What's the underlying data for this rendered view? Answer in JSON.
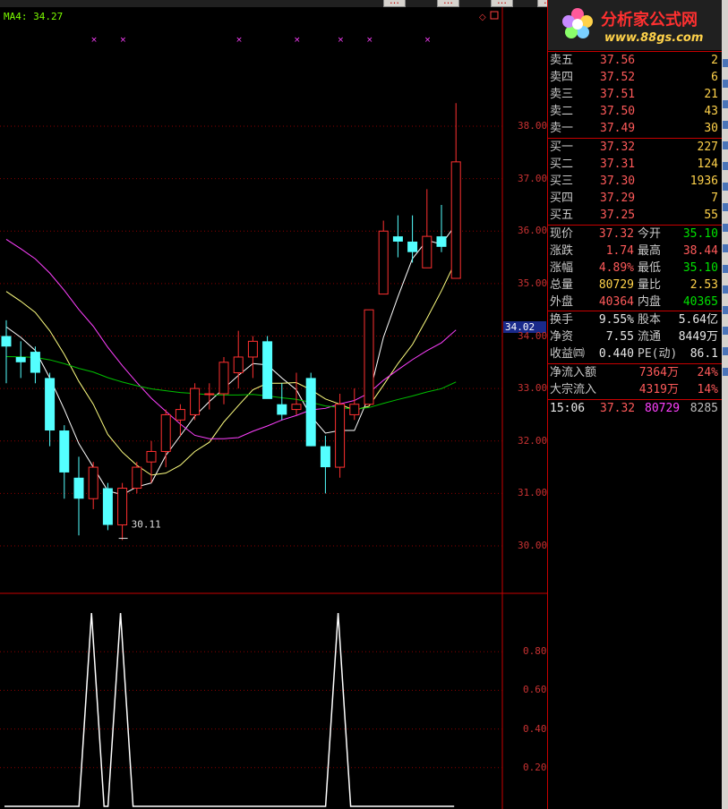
{
  "toolbar": {
    "buttons": [
      "…",
      "…",
      "…",
      "…"
    ]
  },
  "indicator": {
    "ma_label": "MA4: 34.27"
  },
  "price_axis": {
    "ticks": [
      "38.00",
      "37.00",
      "36.00",
      "35.00",
      "34.00",
      "33.00",
      "32.00",
      "31.00",
      "30.00"
    ],
    "current_price_tag": "34.02",
    "low_annotation": "30.11"
  },
  "lower_axis": {
    "ticks": [
      "0.80",
      "0.60",
      "0.40",
      "0.20"
    ]
  },
  "logo": {
    "line1": "分析家公式网",
    "line2": "www.88gs.com"
  },
  "order_book": {
    "asks": [
      {
        "label": "卖五",
        "price": "37.56",
        "vol": "2"
      },
      {
        "label": "卖四",
        "price": "37.52",
        "vol": "6"
      },
      {
        "label": "卖三",
        "price": "37.51",
        "vol": "21"
      },
      {
        "label": "卖二",
        "price": "37.50",
        "vol": "43"
      },
      {
        "label": "卖一",
        "price": "37.49",
        "vol": "30"
      }
    ],
    "bids": [
      {
        "label": "买一",
        "price": "37.32",
        "vol": "227"
      },
      {
        "label": "买二",
        "price": "37.31",
        "vol": "124"
      },
      {
        "label": "买三",
        "price": "37.30",
        "vol": "1936"
      },
      {
        "label": "买四",
        "price": "37.29",
        "vol": "7"
      },
      {
        "label": "买五",
        "price": "37.25",
        "vol": "55"
      }
    ]
  },
  "quote": {
    "rows": [
      {
        "l1": "现价",
        "v1": "37.32",
        "l2": "今开",
        "v2": "35.10"
      },
      {
        "l1": "涨跌",
        "v1": "1.74",
        "l2": "最高",
        "v2": "38.44"
      },
      {
        "l1": "涨幅",
        "v1": "4.89%",
        "l2": "最低",
        "v2": "35.10"
      },
      {
        "l1": "总量",
        "v1": "80729",
        "l2": "量比",
        "v2": "2.53"
      },
      {
        "l1": "外盘",
        "v1": "40364",
        "l2": "内盘",
        "v2": "40365"
      }
    ]
  },
  "fundamentals": {
    "rows": [
      {
        "l1": "换手",
        "v1": "9.55%",
        "l2": "股本",
        "v2": "5.64亿"
      },
      {
        "l1": "净资",
        "v1": "7.55",
        "l2": "流通",
        "v2": "8449万"
      },
      {
        "l1": "收益㈣",
        "v1": "0.440",
        "l2": "PE(动)",
        "v2": "86.1"
      }
    ]
  },
  "flows": {
    "rows": [
      {
        "label": "净流入额",
        "value": "7364万",
        "pct": "24%"
      },
      {
        "label": "大宗流入",
        "value": "4319万",
        "pct": "14%"
      }
    ]
  },
  "tick": {
    "time": "15:06",
    "price": "37.32",
    "volume": "80729",
    "count": "8285"
  },
  "colors": {
    "up": "#ff3030",
    "down": "#54ffff",
    "ma1": "#ffffff",
    "ma2": "#ffff80",
    "ma3": "#ff40ff",
    "ma4": "#00c000",
    "grid": "#8b0000"
  },
  "chart_data": {
    "type": "candlestick",
    "candles": [
      {
        "o": 34.0,
        "h": 34.3,
        "l": 33.1,
        "c": 33.8
      },
      {
        "o": 33.6,
        "h": 33.9,
        "l": 33.2,
        "c": 33.5
      },
      {
        "o": 33.7,
        "h": 33.8,
        "l": 33.1,
        "c": 33.3
      },
      {
        "o": 33.2,
        "h": 33.3,
        "l": 31.9,
        "c": 32.2
      },
      {
        "o": 32.2,
        "h": 32.3,
        "l": 30.9,
        "c": 31.4
      },
      {
        "o": 31.3,
        "h": 31.7,
        "l": 30.2,
        "c": 30.9
      },
      {
        "o": 30.9,
        "h": 31.6,
        "l": 30.7,
        "c": 31.5
      },
      {
        "o": 31.1,
        "h": 31.2,
        "l": 30.3,
        "c": 30.4
      },
      {
        "o": 30.4,
        "h": 31.2,
        "l": 30.11,
        "c": 31.1
      },
      {
        "o": 31.1,
        "h": 31.6,
        "l": 31.0,
        "c": 31.5
      },
      {
        "o": 31.6,
        "h": 32.0,
        "l": 31.2,
        "c": 31.8
      },
      {
        "o": 31.8,
        "h": 32.6,
        "l": 31.5,
        "c": 32.5
      },
      {
        "o": 32.4,
        "h": 32.7,
        "l": 32.1,
        "c": 32.6
      },
      {
        "o": 32.5,
        "h": 33.1,
        "l": 32.4,
        "c": 33.0
      },
      {
        "o": 32.9,
        "h": 33.1,
        "l": 32.6,
        "c": 32.9
      },
      {
        "o": 32.9,
        "h": 33.6,
        "l": 32.7,
        "c": 33.5
      },
      {
        "o": 33.3,
        "h": 34.1,
        "l": 33.0,
        "c": 33.6
      },
      {
        "o": 33.6,
        "h": 34.0,
        "l": 33.2,
        "c": 33.9
      },
      {
        "o": 33.9,
        "h": 34.0,
        "l": 32.9,
        "c": 32.8
      },
      {
        "o": 32.7,
        "h": 33.1,
        "l": 32.4,
        "c": 32.5
      },
      {
        "o": 32.6,
        "h": 33.3,
        "l": 32.5,
        "c": 32.7
      },
      {
        "o": 33.2,
        "h": 33.3,
        "l": 31.9,
        "c": 31.9
      },
      {
        "o": 31.9,
        "h": 32.1,
        "l": 31.0,
        "c": 31.5
      },
      {
        "o": 31.5,
        "h": 32.9,
        "l": 31.3,
        "c": 32.7
      },
      {
        "o": 32.5,
        "h": 33.0,
        "l": 32.4,
        "c": 32.7
      },
      {
        "o": 32.7,
        "h": 34.5,
        "l": 32.7,
        "c": 34.5
      },
      {
        "o": 34.8,
        "h": 36.2,
        "l": 34.8,
        "c": 36.0
      },
      {
        "o": 35.9,
        "h": 36.3,
        "l": 35.5,
        "c": 35.8
      },
      {
        "o": 35.8,
        "h": 36.3,
        "l": 35.4,
        "c": 35.6
      },
      {
        "o": 35.3,
        "h": 36.8,
        "l": 35.3,
        "c": 35.9
      },
      {
        "o": 35.9,
        "h": 36.5,
        "l": 35.6,
        "c": 35.7
      },
      {
        "o": 35.1,
        "h": 38.44,
        "l": 35.1,
        "c": 37.32
      }
    ],
    "ylim": [
      29.9,
      38.6
    ],
    "lower_panel": {
      "ylim": [
        0,
        1
      ],
      "signal": [
        0,
        0,
        0,
        0,
        0,
        0,
        1,
        0,
        1,
        0,
        0,
        0,
        0,
        0,
        0,
        0,
        0,
        0,
        0,
        0,
        0,
        0,
        0,
        1,
        0,
        0,
        0,
        0,
        0,
        0,
        0,
        0
      ]
    }
  }
}
